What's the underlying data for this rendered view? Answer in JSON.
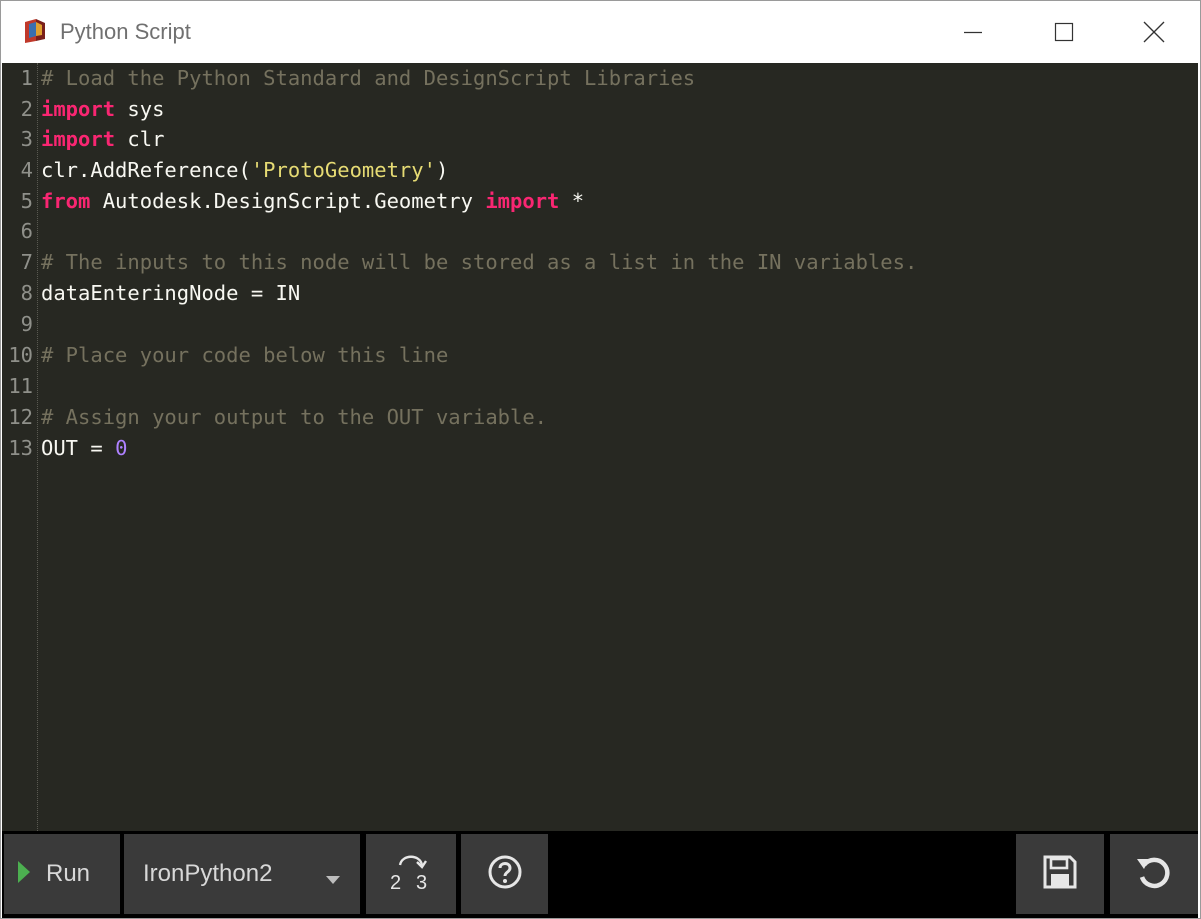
{
  "window": {
    "title": "Python Script",
    "app_icon": "dynamo-app-icon",
    "controls": [
      "minimize-icon",
      "maximize-icon",
      "close-icon"
    ]
  },
  "editor": {
    "theme": {
      "background": "#272822",
      "comment": "#75715e",
      "keyword": "#f92672",
      "string": "#e6db74",
      "number": "#ae81ff",
      "text": "#f8f8f2"
    },
    "lines": [
      {
        "number": "1",
        "tokens": [
          {
            "t": "comment",
            "v": "# Load the Python Standard and DesignScript Libraries"
          }
        ]
      },
      {
        "number": "2",
        "tokens": [
          {
            "t": "kw",
            "v": "import"
          },
          {
            "t": "plain",
            "v": " sys"
          }
        ]
      },
      {
        "number": "3",
        "tokens": [
          {
            "t": "kw",
            "v": "import"
          },
          {
            "t": "plain",
            "v": " clr"
          }
        ]
      },
      {
        "number": "4",
        "tokens": [
          {
            "t": "plain",
            "v": "clr.AddReference("
          },
          {
            "t": "str",
            "v": "'ProtoGeometry'"
          },
          {
            "t": "plain",
            "v": ")"
          }
        ]
      },
      {
        "number": "5",
        "tokens": [
          {
            "t": "kw",
            "v": "from"
          },
          {
            "t": "plain",
            "v": " Autodesk.DesignScript.Geometry "
          },
          {
            "t": "kw",
            "v": "import"
          },
          {
            "t": "plain",
            "v": " *"
          }
        ]
      },
      {
        "number": "6",
        "tokens": []
      },
      {
        "number": "7",
        "tokens": [
          {
            "t": "comment",
            "v": "# The inputs to this node will be stored as a list in the IN variables."
          }
        ]
      },
      {
        "number": "8",
        "tokens": [
          {
            "t": "plain",
            "v": "dataEnteringNode = IN"
          }
        ]
      },
      {
        "number": "9",
        "tokens": []
      },
      {
        "number": "10",
        "tokens": [
          {
            "t": "comment",
            "v": "# Place your code below this line"
          }
        ]
      },
      {
        "number": "11",
        "tokens": []
      },
      {
        "number": "12",
        "tokens": [
          {
            "t": "comment",
            "v": "# Assign your output to the OUT variable."
          }
        ]
      },
      {
        "number": "13",
        "tokens": [
          {
            "t": "plain",
            "v": "OUT = "
          },
          {
            "t": "num",
            "v": "0"
          }
        ]
      }
    ]
  },
  "toolbar": {
    "run_label": "Run",
    "engine_selected": "IronPython2",
    "convert_icon": "convert-2to3-icon",
    "convert_digits": {
      "left": "2",
      "right": "3"
    },
    "help_icon": "help-icon",
    "save_icon": "save-icon",
    "revert_icon": "revert-icon"
  }
}
